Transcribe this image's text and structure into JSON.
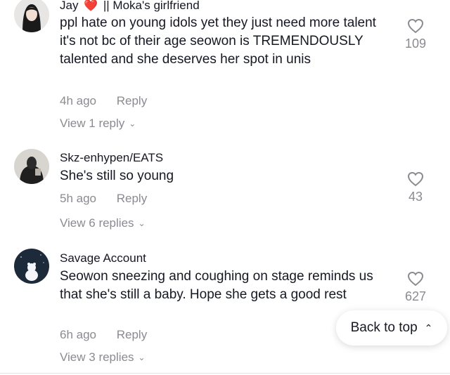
{
  "comments": [
    {
      "username": "Jay",
      "username_suffix": "|| Moka's girlfriend",
      "text": "ppl hate on young idols yet they just need more talent it's not bc of their age seowon is TREMENDOUSLY talented and she deserves her spot in unis",
      "time": "4h ago",
      "reply_label": "Reply",
      "likes": "109",
      "view_replies": "View 1 reply"
    },
    {
      "username": "Skz-enhypen/EATS",
      "text": "She's still so young",
      "time": "5h ago",
      "reply_label": "Reply",
      "likes": "43",
      "view_replies": "View 6 replies"
    },
    {
      "username": "Savage Account",
      "text": "Seowon sneezing and coughing on stage reminds us that she's still a baby. Hope she gets a good rest",
      "time": "6h ago",
      "reply_label": "Reply",
      "likes": "627",
      "view_replies": "View 3 replies"
    }
  ],
  "back_to_top": "Back to top",
  "icons": {
    "like": "heart-outline-icon",
    "badge": "heart-badge-icon",
    "chevron": "chevron-down-icon",
    "up": "double-chevron-up-icon"
  },
  "colors": {
    "text": "#161823",
    "muted": "#8a8b91",
    "badge": "#e0245e"
  }
}
